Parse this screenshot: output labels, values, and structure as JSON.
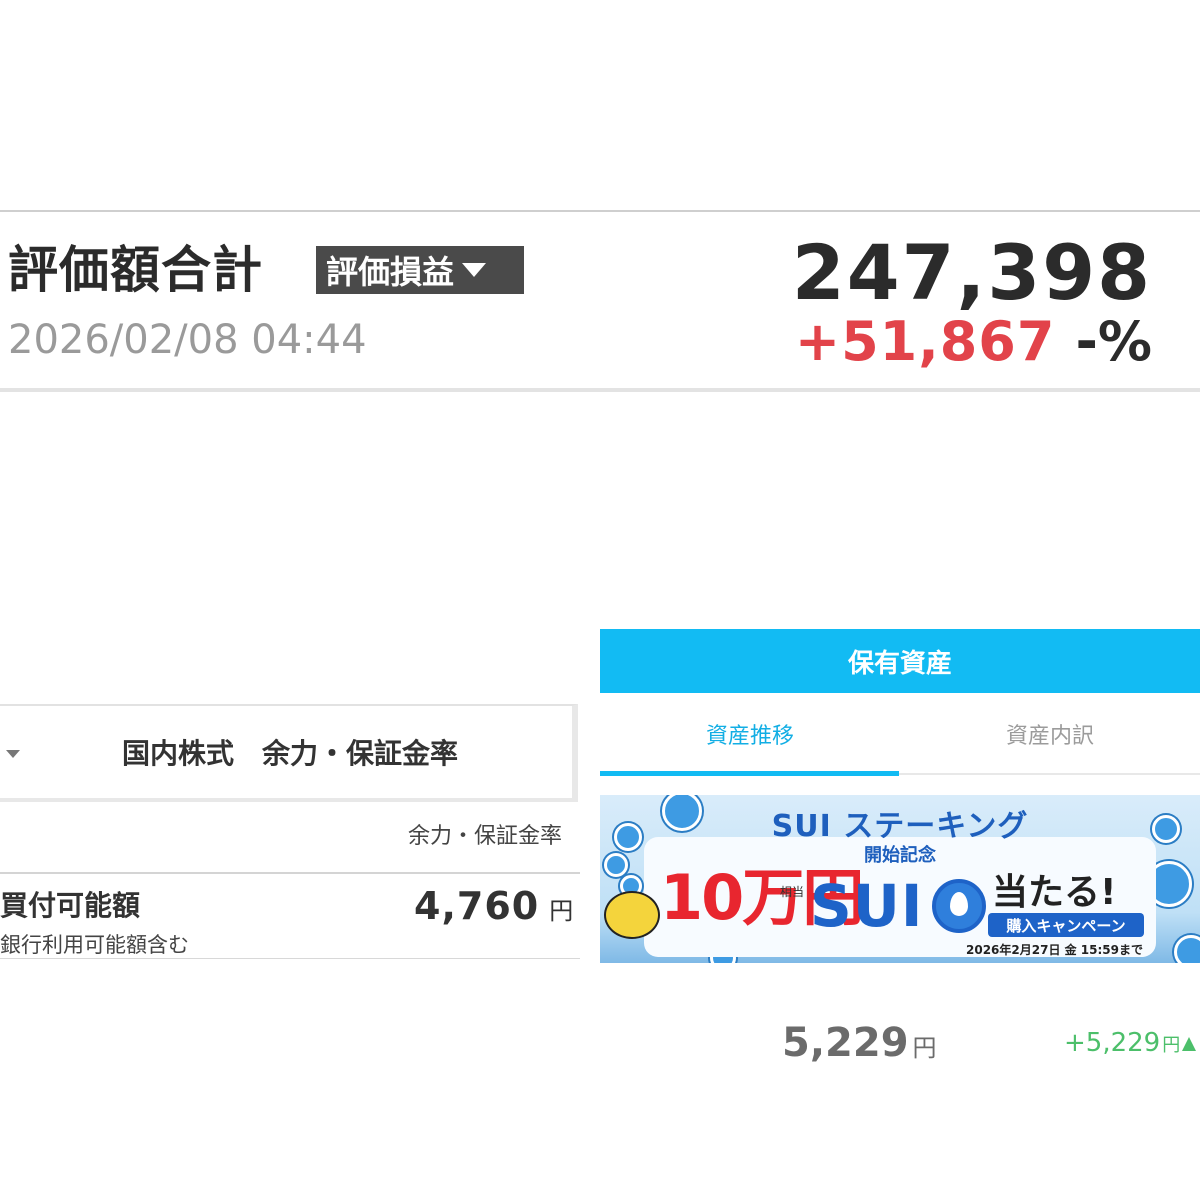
{
  "valuation": {
    "title": "評価額合計",
    "dropdown_label": "評価損益",
    "datetime": "2026/02/08 04:44",
    "total_amount": "247,398",
    "change_amount": "+51,867",
    "change_percent": "-%"
  },
  "domestic_stock": {
    "header_title": "国内株式　余力・保証金率",
    "subheader": "余力・保証金率",
    "buying_power_label": "買付可能額",
    "buying_power_value": "4,760",
    "buying_power_unit": "円",
    "buying_power_note": "銀行利用可能額含む"
  },
  "holdings": {
    "header": "保有資産",
    "tabs": [
      {
        "label": "資産推移",
        "active": true
      },
      {
        "label": "資産内訳",
        "active": false
      }
    ],
    "total_value": "5,229",
    "total_unit": "円",
    "gain_value": "+5,229",
    "gain_unit": "円"
  },
  "banner": {
    "title": "SUI ステーキング",
    "subtitle": "開始記念",
    "prize": "10万円",
    "prize_equiv": "相当",
    "coin_name": "SUI",
    "win_text": "当たる!",
    "campaign_label": "購入キャンペーン",
    "deadline": "2026年2月27日 金 15:59まで"
  },
  "colors": {
    "accent": "#12bbf3",
    "loss_gain_red": "#e2434a",
    "gain_green": "#4cbf6a",
    "dropdown_bg": "#4a4a4a"
  }
}
